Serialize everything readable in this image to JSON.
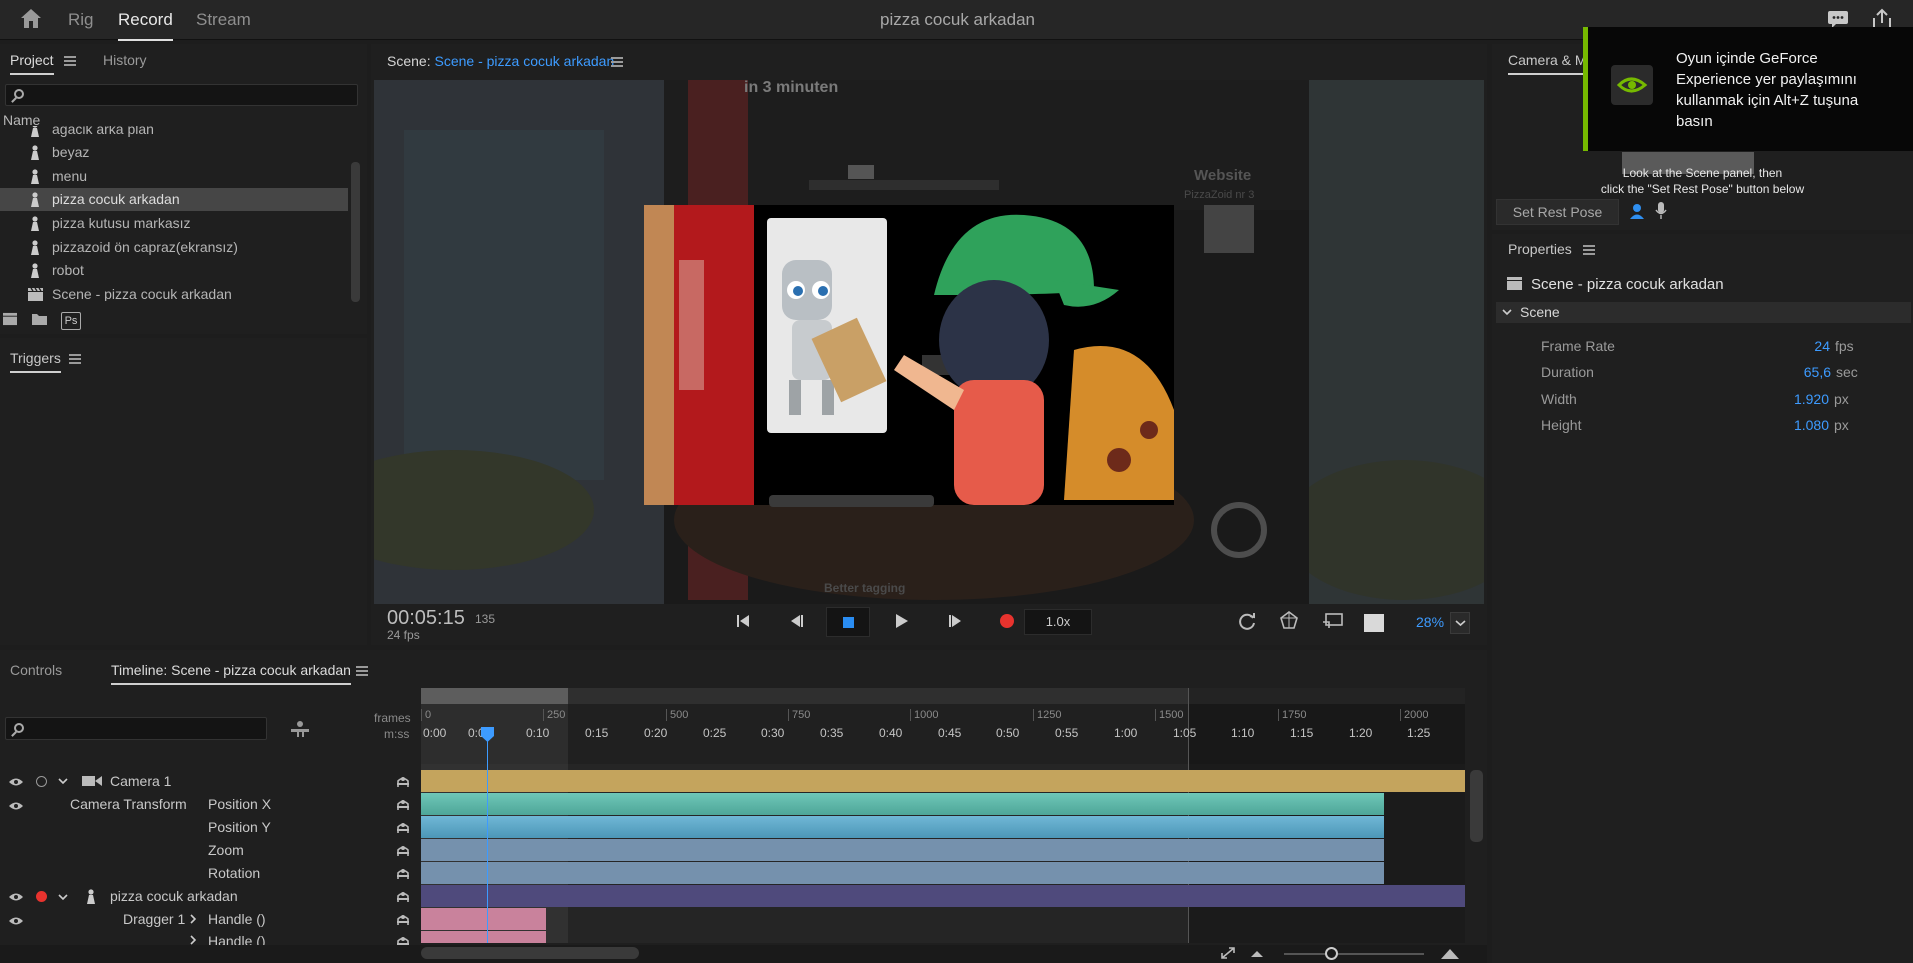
{
  "app": {
    "modes": [
      "Rig",
      "Record",
      "Stream"
    ],
    "active_mode": "Record",
    "document_title": "pizza cocuk arkadan"
  },
  "project_panel": {
    "tabs": [
      "Project",
      "History"
    ],
    "search_placeholder": "",
    "column_header": "Name",
    "items": [
      {
        "label": "agacik arka plan",
        "type": "puppet",
        "selected": false
      },
      {
        "label": "beyaz",
        "type": "puppet",
        "selected": false
      },
      {
        "label": "menu",
        "type": "puppet",
        "selected": false
      },
      {
        "label": "pizza cocuk arkadan",
        "type": "puppet",
        "selected": true
      },
      {
        "label": "pizza kutusu markasız",
        "type": "puppet",
        "selected": false
      },
      {
        "label": "pizzazoid ön capraz(ekransız)",
        "type": "puppet",
        "selected": false
      },
      {
        "label": "robot",
        "type": "puppet",
        "selected": false
      },
      {
        "label": "Scene - pizza cocuk arkadan",
        "type": "scene",
        "selected": false
      }
    ],
    "footer_icons": [
      "new-scene-icon",
      "folder-icon",
      "photoshop-icon"
    ],
    "ps_label": "Ps"
  },
  "triggers_panel": {
    "title": "Triggers"
  },
  "scene_panel": {
    "label": "Scene:",
    "name": "Scene - pizza cocuk arkadan",
    "viewer_texts": {
      "banner": "in 3 minuten",
      "website": "Website",
      "website_sub": "PizzaZoid nr 3",
      "bottom": "Better tagging"
    },
    "timecode": "00:05:15",
    "frame": "135",
    "fps": "24 fps",
    "speed": "1.0x",
    "zoom": "28%"
  },
  "camera_panel": {
    "tab": "Camera & M",
    "instruction_line1": "Look at the Scene panel, then",
    "instruction_line2": "click the \"Set Rest Pose\" button below",
    "set_rest_pose": "Set Rest Pose"
  },
  "properties_panel": {
    "title": "Properties",
    "item_name": "Scene - pizza cocuk arkadan",
    "section": "Scene",
    "rows": [
      {
        "label": "Frame Rate",
        "value": "24",
        "unit": "fps"
      },
      {
        "label": "Duration",
        "value": "65,6",
        "unit": "sec"
      },
      {
        "label": "Width",
        "value": "1.920",
        "unit": "px"
      },
      {
        "label": "Height",
        "value": "1.080",
        "unit": "px"
      }
    ]
  },
  "notification": {
    "text": "Oyun içinde GeForce Experience yer paylaşımını kullanmak için Alt+Z tuşuna basın"
  },
  "bottom_tabs": {
    "controls": "Controls",
    "timeline": "Timeline: Scene - pizza cocuk arkadan"
  },
  "timeline": {
    "frames_label": "frames",
    "mss_label": "m:ss",
    "frame_ticks": [
      "0",
      "250",
      "500",
      "750",
      "1000",
      "1250",
      "1500",
      "1750",
      "2000"
    ],
    "time_ticks": [
      "0:00",
      "0:05",
      "0:10",
      "0:15",
      "0:20",
      "0:25",
      "0:30",
      "0:35",
      "0:40",
      "0:45",
      "0:50",
      "0:55",
      "1:00",
      "1:05",
      "1:10",
      "1:15",
      "1:20",
      "1:25"
    ],
    "rows": [
      {
        "col1": "Camera 1",
        "col2": "",
        "color": "#c4a45d"
      },
      {
        "col1": "Camera Transform",
        "col2": "Position X",
        "color": "#5fb8aa"
      },
      {
        "col1": "",
        "col2": "Position Y",
        "color": "#5fa9c8"
      },
      {
        "col1": "",
        "col2": "Zoom",
        "color": "#6c8fb0"
      },
      {
        "col1": "",
        "col2": "Rotation",
        "color": "#6c8fb0"
      },
      {
        "col1": "pizza cocuk arkadan",
        "col2": "",
        "color": "#4f4a7c"
      },
      {
        "col1": "Dragger 1",
        "col2": "Handle ()",
        "color": "#c9829c"
      },
      {
        "col1": "",
        "col2": "Handle ()",
        "color": "#c9829c"
      }
    ]
  }
}
